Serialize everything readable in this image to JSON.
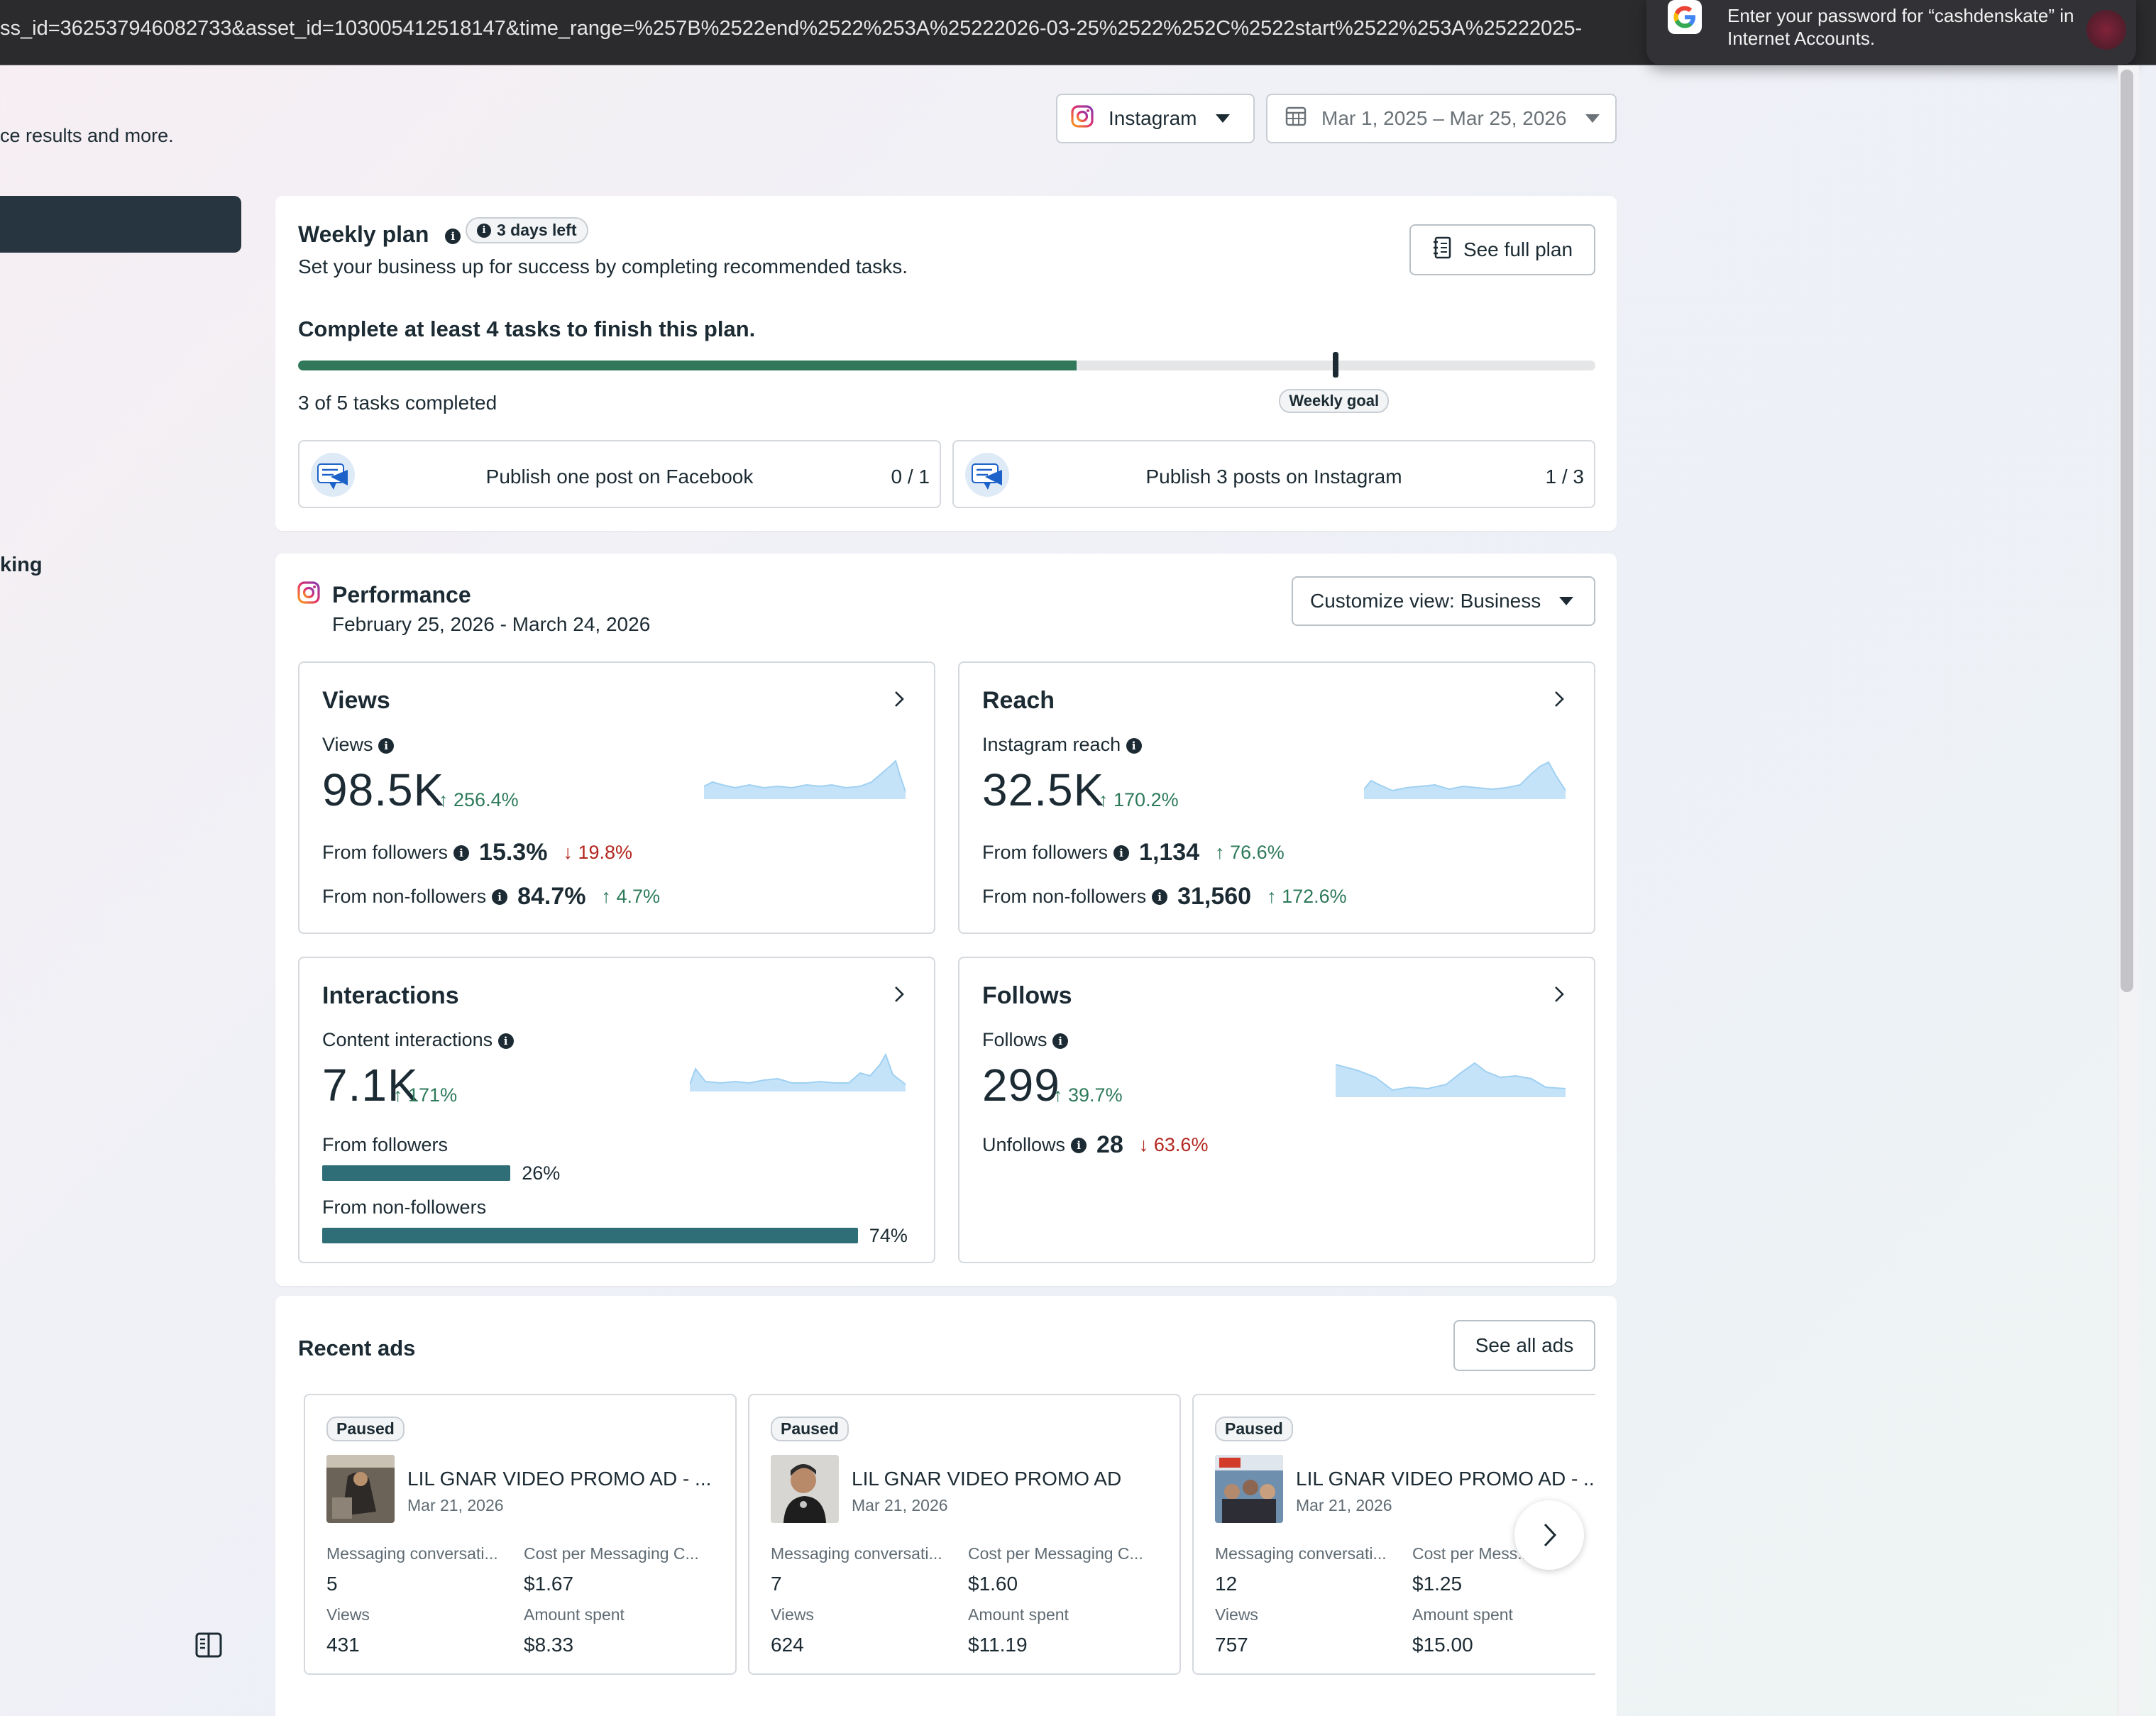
{
  "browser": {
    "url": "ss_id=362537946082733&asset_id=103005412518147&time_range=%257B%2522end%2522%253A%25222026-03-25%2522%252C%2522start%2522%253A%25222025-",
    "password_prompt": "Enter your password for “cashdenskate” in Internet Accounts."
  },
  "sidebar": {
    "partial_text": "ce results and more.",
    "partial_item": "king"
  },
  "header": {
    "platform": "Instagram",
    "date_range": "Mar 1, 2025 – Mar 25, 2026"
  },
  "weekly_plan": {
    "title": "Weekly plan",
    "days_left": "3 days left",
    "subtitle": "Set your business up for success by completing recommended tasks.",
    "see_full_plan": "See full plan",
    "goal_text": "Complete at least 4 tasks to finish this plan.",
    "progress_fraction": 0.6,
    "goal_fraction": 0.8,
    "completed_text": "3 of 5 tasks completed",
    "goal_label": "Weekly goal",
    "tasks": [
      {
        "name": "Publish one post on Facebook",
        "count": "0 / 1"
      },
      {
        "name": "Publish 3 posts on Instagram",
        "count": "1 / 3"
      }
    ]
  },
  "performance": {
    "title": "Performance",
    "date_range": "February 25, 2026 - March 24, 2026",
    "customize": "Customize view: Business",
    "views": {
      "title": "Views",
      "label": "Views",
      "value": "98.5K",
      "delta": "256.4%",
      "followers_label": "From followers",
      "followers_value": "15.3%",
      "followers_delta": "19.8%",
      "nonfollowers_label": "From non-followers",
      "nonfollowers_value": "84.7%",
      "nonfollowers_delta": "4.7%"
    },
    "reach": {
      "title": "Reach",
      "label": "Instagram reach",
      "value": "32.5K",
      "delta": "170.2%",
      "followers_label": "From followers",
      "followers_value": "1,134",
      "followers_delta": "76.6%",
      "nonfollowers_label": "From non-followers",
      "nonfollowers_value": "31,560",
      "nonfollowers_delta": "172.6%"
    },
    "interactions": {
      "title": "Interactions",
      "label": "Content interactions",
      "value": "7.1K",
      "delta": "171%",
      "followers_label": "From followers",
      "followers_pct": "26%",
      "followers_fraction": 0.26,
      "nonfollowers_label": "From non-followers",
      "nonfollowers_pct": "74%",
      "nonfollowers_fraction": 0.74
    },
    "follows": {
      "title": "Follows",
      "label": "Follows",
      "value": "299",
      "delta": "39.7%",
      "unfollows_label": "Unfollows",
      "unfollows_value": "28",
      "unfollows_delta": "63.6%"
    }
  },
  "recent_ads": {
    "title": "Recent ads",
    "see_all": "See all ads",
    "ads": [
      {
        "status": "Paused",
        "name": "LIL GNAR VIDEO PROMO AD - ...",
        "date": "Mar 21, 2026",
        "k1": "Messaging conversati...",
        "v1": "5",
        "k2": "Cost per Messaging C...",
        "v2": "$1.67",
        "k3": "Views",
        "v3": "431",
        "k4": "Amount spent",
        "v4": "$8.33"
      },
      {
        "status": "Paused",
        "name": "LIL GNAR VIDEO PROMO AD",
        "date": "Mar 21, 2026",
        "k1": "Messaging conversati...",
        "v1": "7",
        "k2": "Cost per Messaging C...",
        "v2": "$1.60",
        "k3": "Views",
        "v3": "624",
        "k4": "Amount spent",
        "v4": "$11.19"
      },
      {
        "status": "Paused",
        "name": "LIL GNAR VIDEO PROMO AD - ...",
        "date": "Mar 21, 2026",
        "k1": "Messaging conversati...",
        "v1": "12",
        "k2": "Cost per Mess...",
        "v2": "$1.25",
        "k3": "Views",
        "v3": "757",
        "k4": "Amount spent",
        "v4": "$15.00"
      }
    ]
  },
  "colors": {
    "accent_green": "#31785a",
    "bar_teal": "#2f6e76",
    "up": "#2d7a5a",
    "down": "#b3261e",
    "spark": "#bfe0f7"
  }
}
